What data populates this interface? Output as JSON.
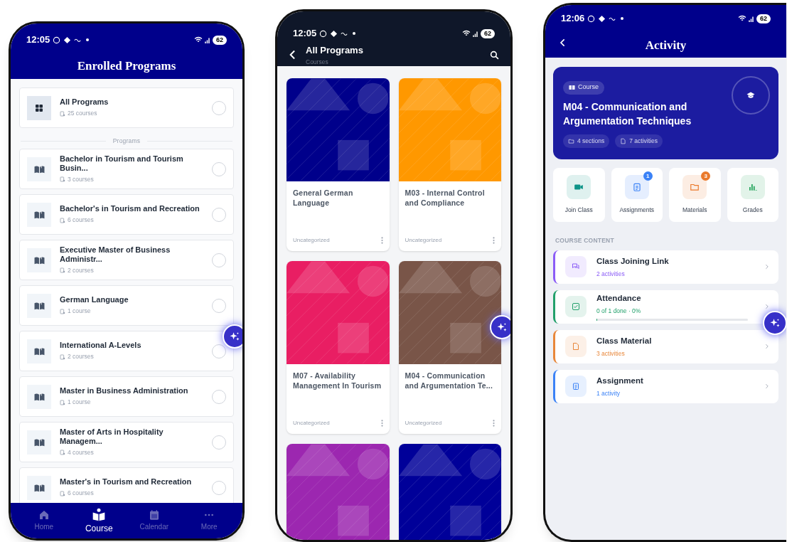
{
  "programs_screen": {
    "status": {
      "time": "12:05",
      "battery": "62"
    },
    "title": "Enrolled Programs",
    "all_programs": {
      "title": "All Programs",
      "count": "25 courses",
      "selected": false
    },
    "section_label": "Programs",
    "programs": [
      {
        "title": "Bachelor in Tourism and Tourism Busin...",
        "count": "3 courses",
        "selected": false
      },
      {
        "title": "Bachelor's in Tourism and Recreation",
        "count": "6 courses",
        "selected": false
      },
      {
        "title": "Executive Master of Business Administr...",
        "count": "2 courses",
        "selected": false
      },
      {
        "title": "German Language",
        "count": "1 course",
        "selected": false
      },
      {
        "title": "International A-Levels",
        "count": "2 courses",
        "selected": false
      },
      {
        "title": "Master in Business Administration",
        "count": "1 course",
        "selected": false
      },
      {
        "title": "Master of Arts in Hospitality Managem...",
        "count": "4 courses",
        "selected": false
      },
      {
        "title": "Master's in Tourism and Recreation",
        "count": "6 courses",
        "selected": false
      }
    ],
    "nav": [
      {
        "kind": "home",
        "label": "Home",
        "selected": false
      },
      {
        "kind": "course",
        "label": "Course",
        "selected": true
      },
      {
        "kind": "calendar",
        "label": "Calendar",
        "selected": false
      },
      {
        "kind": "more",
        "label": "More",
        "selected": false
      }
    ]
  },
  "courses_screen": {
    "status": {
      "time": "12:05",
      "battery": "62"
    },
    "title": "All Programs",
    "subtitle": "Courses",
    "courses": [
      {
        "title": "General German Language",
        "category": "Uncategorized",
        "color": "#00008b"
      },
      {
        "title": "M03 - Internal Control and Compliance",
        "category": "Uncategorized",
        "color": "#ff9800"
      },
      {
        "title": "M07 - Availability Management In Tourism",
        "category": "Uncategorized",
        "color": "#e91e63"
      },
      {
        "title": "M04 - Communication and Argumentation Te...",
        "category": "Uncategorized",
        "color": "#795548"
      },
      {
        "color": "#9c27b0"
      },
      {
        "color": "#000099"
      }
    ]
  },
  "activity_screen": {
    "status": {
      "time": "12:06",
      "battery": "62"
    },
    "title": "Activity",
    "hero": {
      "badge": "Course",
      "title": "M04 - Communication and Argumentation Techniques",
      "chips": [
        {
          "kind": "folder",
          "label": "4 sections"
        },
        {
          "kind": "file",
          "label": "7 activities"
        }
      ]
    },
    "actions": [
      {
        "kind": "video",
        "label": "Join Class",
        "color": "#0d9488"
      },
      {
        "kind": "clipboard",
        "label": "Assignments",
        "badge": "1",
        "color": "#3b82f6"
      },
      {
        "kind": "folder",
        "label": "Materials",
        "badge": "3",
        "color": "#ea7a2c"
      },
      {
        "kind": "chart",
        "label": "Grades",
        "color": "#22a35a"
      }
    ],
    "section_label": "COURSE CONTENT",
    "sections": [
      {
        "kind": "chat",
        "title": "Class Joining Link",
        "detail": "2 activities",
        "color": "#8b5cf6"
      },
      {
        "kind": "check",
        "title": "Attendance",
        "detail": "0 of 1 done · 0%",
        "color": "#22a06b",
        "level": 0
      },
      {
        "kind": "file",
        "title": "Class Material",
        "detail": "3 activities",
        "color": "#e8873a"
      },
      {
        "kind": "clipboard",
        "title": "Assignment",
        "detail": "1 activity",
        "color": "#3b82f6"
      }
    ]
  }
}
